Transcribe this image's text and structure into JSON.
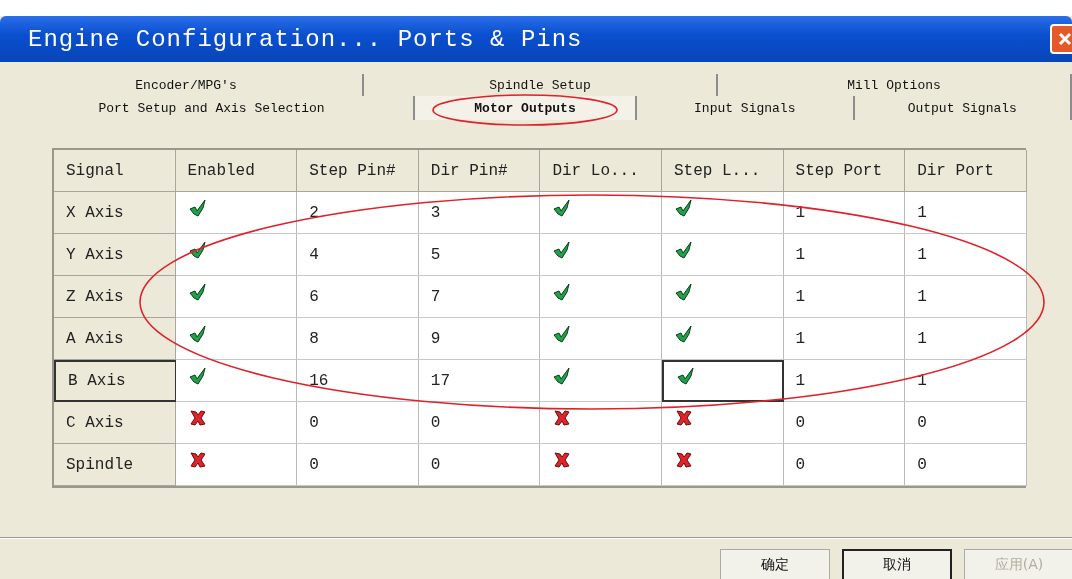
{
  "window": {
    "title": "Engine Configuration... Ports & Pins"
  },
  "tab_rows": [
    [
      {
        "label": "Encoder/MPG's",
        "selected": false
      },
      {
        "label": "Spindle Setup",
        "selected": false
      },
      {
        "label": "Mill Options",
        "selected": false
      }
    ],
    [
      {
        "label": "Port Setup and Axis Selection",
        "selected": false
      },
      {
        "label": "Motor Outputs",
        "selected": true
      },
      {
        "label": "Input Signals",
        "selected": false
      },
      {
        "label": "Output Signals",
        "selected": false
      }
    ]
  ],
  "table": {
    "columns": [
      "Signal",
      "Enabled",
      "Step Pin#",
      "Dir Pin#",
      "Dir Lo...",
      "Step L...",
      "Step Port",
      "Dir Port"
    ],
    "rows": [
      {
        "selected": false,
        "cells": [
          {
            "kind": "label",
            "text": "X Axis"
          },
          {
            "kind": "check",
            "checked": true,
            "focused": false
          },
          {
            "kind": "text",
            "text": "2"
          },
          {
            "kind": "text",
            "text": "3"
          },
          {
            "kind": "check",
            "checked": true,
            "focused": false
          },
          {
            "kind": "check",
            "checked": true,
            "focused": false
          },
          {
            "kind": "text",
            "text": "1"
          },
          {
            "kind": "text",
            "text": "1"
          }
        ]
      },
      {
        "selected": false,
        "cells": [
          {
            "kind": "label",
            "text": "Y Axis"
          },
          {
            "kind": "check",
            "checked": true,
            "focused": false
          },
          {
            "kind": "text",
            "text": "4"
          },
          {
            "kind": "text",
            "text": "5"
          },
          {
            "kind": "check",
            "checked": true,
            "focused": false
          },
          {
            "kind": "check",
            "checked": true,
            "focused": false
          },
          {
            "kind": "text",
            "text": "1"
          },
          {
            "kind": "text",
            "text": "1"
          }
        ]
      },
      {
        "selected": false,
        "cells": [
          {
            "kind": "label",
            "text": "Z Axis"
          },
          {
            "kind": "check",
            "checked": true,
            "focused": false
          },
          {
            "kind": "text",
            "text": "6"
          },
          {
            "kind": "text",
            "text": "7"
          },
          {
            "kind": "check",
            "checked": true,
            "focused": false
          },
          {
            "kind": "check",
            "checked": true,
            "focused": false
          },
          {
            "kind": "text",
            "text": "1"
          },
          {
            "kind": "text",
            "text": "1"
          }
        ]
      },
      {
        "selected": false,
        "cells": [
          {
            "kind": "label",
            "text": "A Axis"
          },
          {
            "kind": "check",
            "checked": true,
            "focused": false
          },
          {
            "kind": "text",
            "text": "8"
          },
          {
            "kind": "text",
            "text": "9"
          },
          {
            "kind": "check",
            "checked": true,
            "focused": false
          },
          {
            "kind": "check",
            "checked": true,
            "focused": false
          },
          {
            "kind": "text",
            "text": "1"
          },
          {
            "kind": "text",
            "text": "1"
          }
        ]
      },
      {
        "selected": true,
        "cells": [
          {
            "kind": "label",
            "text": "B Axis"
          },
          {
            "kind": "check",
            "checked": true,
            "focused": false
          },
          {
            "kind": "text",
            "text": "16"
          },
          {
            "kind": "text",
            "text": "17"
          },
          {
            "kind": "check",
            "checked": true,
            "focused": false
          },
          {
            "kind": "check",
            "checked": true,
            "focused": true
          },
          {
            "kind": "text",
            "text": "1"
          },
          {
            "kind": "text",
            "text": "1"
          }
        ]
      },
      {
        "selected": false,
        "cells": [
          {
            "kind": "label",
            "text": "C Axis"
          },
          {
            "kind": "check",
            "checked": false,
            "focused": false
          },
          {
            "kind": "text",
            "text": "0"
          },
          {
            "kind": "text",
            "text": "0"
          },
          {
            "kind": "check",
            "checked": false,
            "focused": false
          },
          {
            "kind": "check",
            "checked": false,
            "focused": false
          },
          {
            "kind": "text",
            "text": "0"
          },
          {
            "kind": "text",
            "text": "0"
          }
        ]
      },
      {
        "selected": false,
        "cells": [
          {
            "kind": "label",
            "text": "Spindle"
          },
          {
            "kind": "check",
            "checked": false,
            "focused": false
          },
          {
            "kind": "text",
            "text": "0"
          },
          {
            "kind": "text",
            "text": "0"
          },
          {
            "kind": "check",
            "checked": false,
            "focused": false
          },
          {
            "kind": "check",
            "checked": false,
            "focused": false
          },
          {
            "kind": "text",
            "text": "0"
          },
          {
            "kind": "text",
            "text": "0"
          }
        ]
      }
    ]
  },
  "buttons": [
    {
      "label": "确定",
      "default": false,
      "disabled": false
    },
    {
      "label": "取消",
      "default": true,
      "disabled": false
    },
    {
      "label": "应用(A)",
      "default": false,
      "disabled": true
    }
  ]
}
